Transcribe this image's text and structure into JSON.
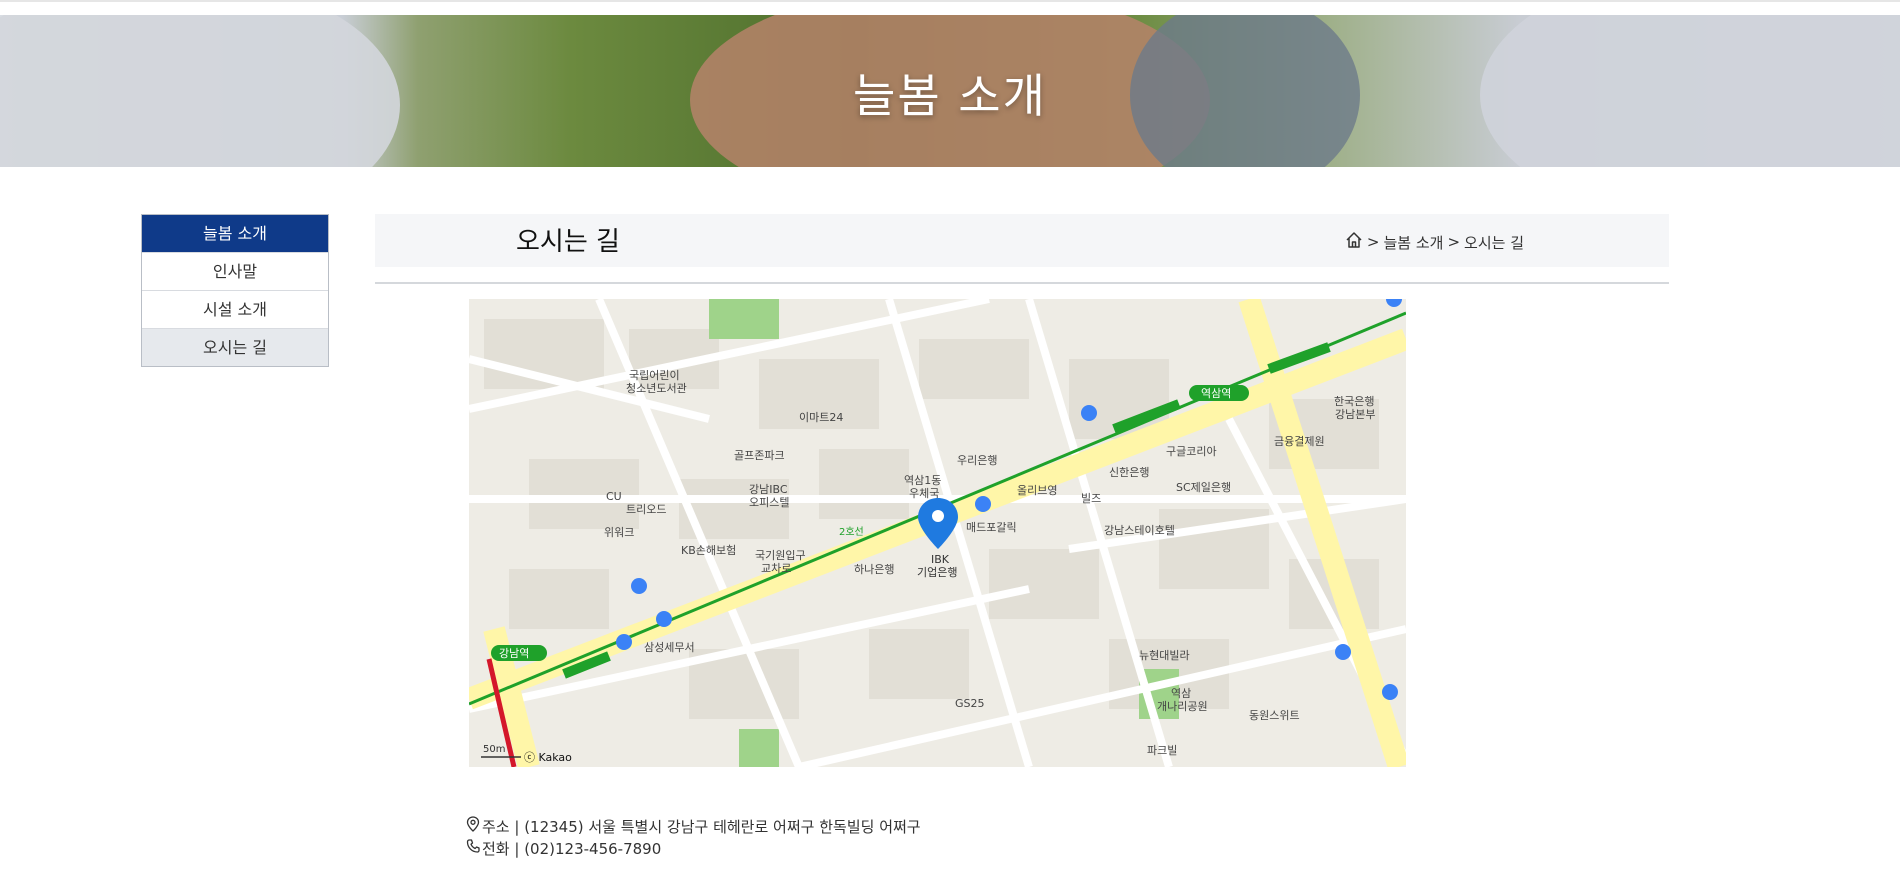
{
  "hero": {
    "title": "늘봄 소개"
  },
  "sidebar": {
    "items": [
      {
        "label": "늘봄 소개"
      },
      {
        "label": "인사말"
      },
      {
        "label": "시설 소개"
      },
      {
        "label": "오시는 길"
      }
    ]
  },
  "content": {
    "title": "오시는 길",
    "breadcrumb": {
      "sep1": ">",
      "level1": "늘봄 소개",
      "sep2": ">",
      "level2": "오시는 길"
    }
  },
  "map": {
    "labels": {
      "station_left": "강남역",
      "station_right": "역삼역",
      "line_label1": "2호선",
      "pin_label_line1": "IBK",
      "pin_label_line2": "기업은행",
      "yeoksam1dong": "역삼1동",
      "yeoksam1dong2": "우체국",
      "woori": "우리은행",
      "madpo": "매드포갈릭",
      "hanayeon": "하나은행",
      "kookjae": "국기원입구",
      "kookjae2": "교차로",
      "samsungse": "삼성세무서",
      "shinhan": "신한은행",
      "googlekorea": "구글코리아",
      "sc": "SC제일은행",
      "geumyung": "금융결제원",
      "korea_bank": "한국은행",
      "korea_bank2": "강남본부",
      "ilmart": "이마트24",
      "golf": "골프존파크",
      "ibc": "강남IBC",
      "ibc2": "오피스텔",
      "jeokangbok": "삼성세무서",
      "kb": "KB손해보험",
      "hyundai": "뉴현대빌라",
      "gs25": "GS25",
      "yeoksam_park": "역삼",
      "yeoksam_park2": "개나리공원",
      "trieod": "트리오드",
      "wework": "위워크",
      "cu": "CU",
      "sonyeon": "국립어린이",
      "sonyeon2": "청소년도서관",
      "gangnamsta": "강남스테이호텔",
      "bills": "빌즈",
      "olive": "올리브영",
      "dongwon": "동원스위트",
      "parkhill": "파크빌",
      "copyright": "ⓒ Kakao",
      "scale": "50m"
    }
  },
  "info": {
    "address": "주소 | (12345) 서울 특별시 강남구 테헤란로 어쩌구 한독빌딩 어쩌구",
    "phone": "전화 | (02)123-456-7890"
  },
  "colors": {
    "primary": "#0f3a89",
    "pin": "#1f7ae0",
    "subway": "#1fa12a",
    "road": "#ffffff",
    "major_road": "#fff6a8"
  }
}
